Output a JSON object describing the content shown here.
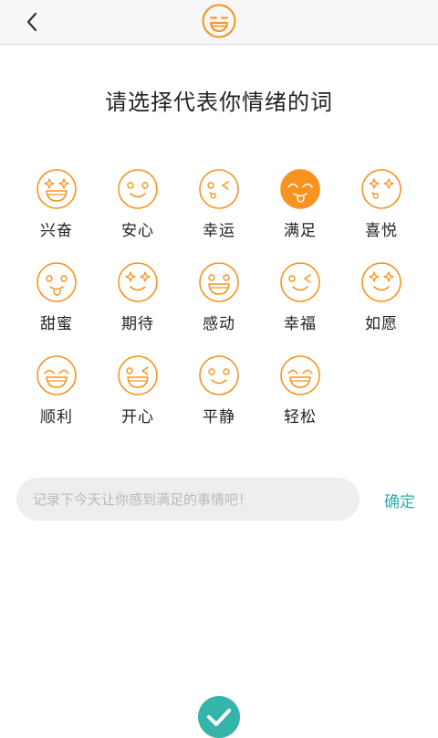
{
  "header": {
    "back_icon": "chevron-left-icon",
    "logo_icon": "smile-face-icon"
  },
  "title": "请选择代表你情绪的词",
  "moods": [
    {
      "label": "兴奋",
      "face": "star-eyes-grin",
      "selected": false
    },
    {
      "label": "安心",
      "face": "smile",
      "selected": false
    },
    {
      "label": "幸运",
      "face": "wink-tongue",
      "selected": false
    },
    {
      "label": "满足",
      "face": "happy-tongue",
      "selected": true
    },
    {
      "label": "喜悦",
      "face": "star-eyes-tongue",
      "selected": false
    },
    {
      "label": "甜蜜",
      "face": "tongue",
      "selected": false
    },
    {
      "label": "期待",
      "face": "star-eyes-smile",
      "selected": false
    },
    {
      "label": "感动",
      "face": "grin",
      "selected": false
    },
    {
      "label": "幸福",
      "face": "wink-smile",
      "selected": false
    },
    {
      "label": "如愿",
      "face": "star-eyes-smile",
      "selected": false
    },
    {
      "label": "顺利",
      "face": "happy-grin",
      "selected": false
    },
    {
      "label": "开心",
      "face": "wink-grin",
      "selected": false
    },
    {
      "label": "平静",
      "face": "smile",
      "selected": false
    },
    {
      "label": "轻松",
      "face": "happy-grin",
      "selected": false
    }
  ],
  "note": {
    "placeholder": "记录下今天让你感到满足的事情吧！",
    "value": ""
  },
  "confirm_label": "确定",
  "submit_icon": "checkmark-icon",
  "colors": {
    "accent_orange": "#F7931E",
    "teal": "#35B5A9"
  }
}
